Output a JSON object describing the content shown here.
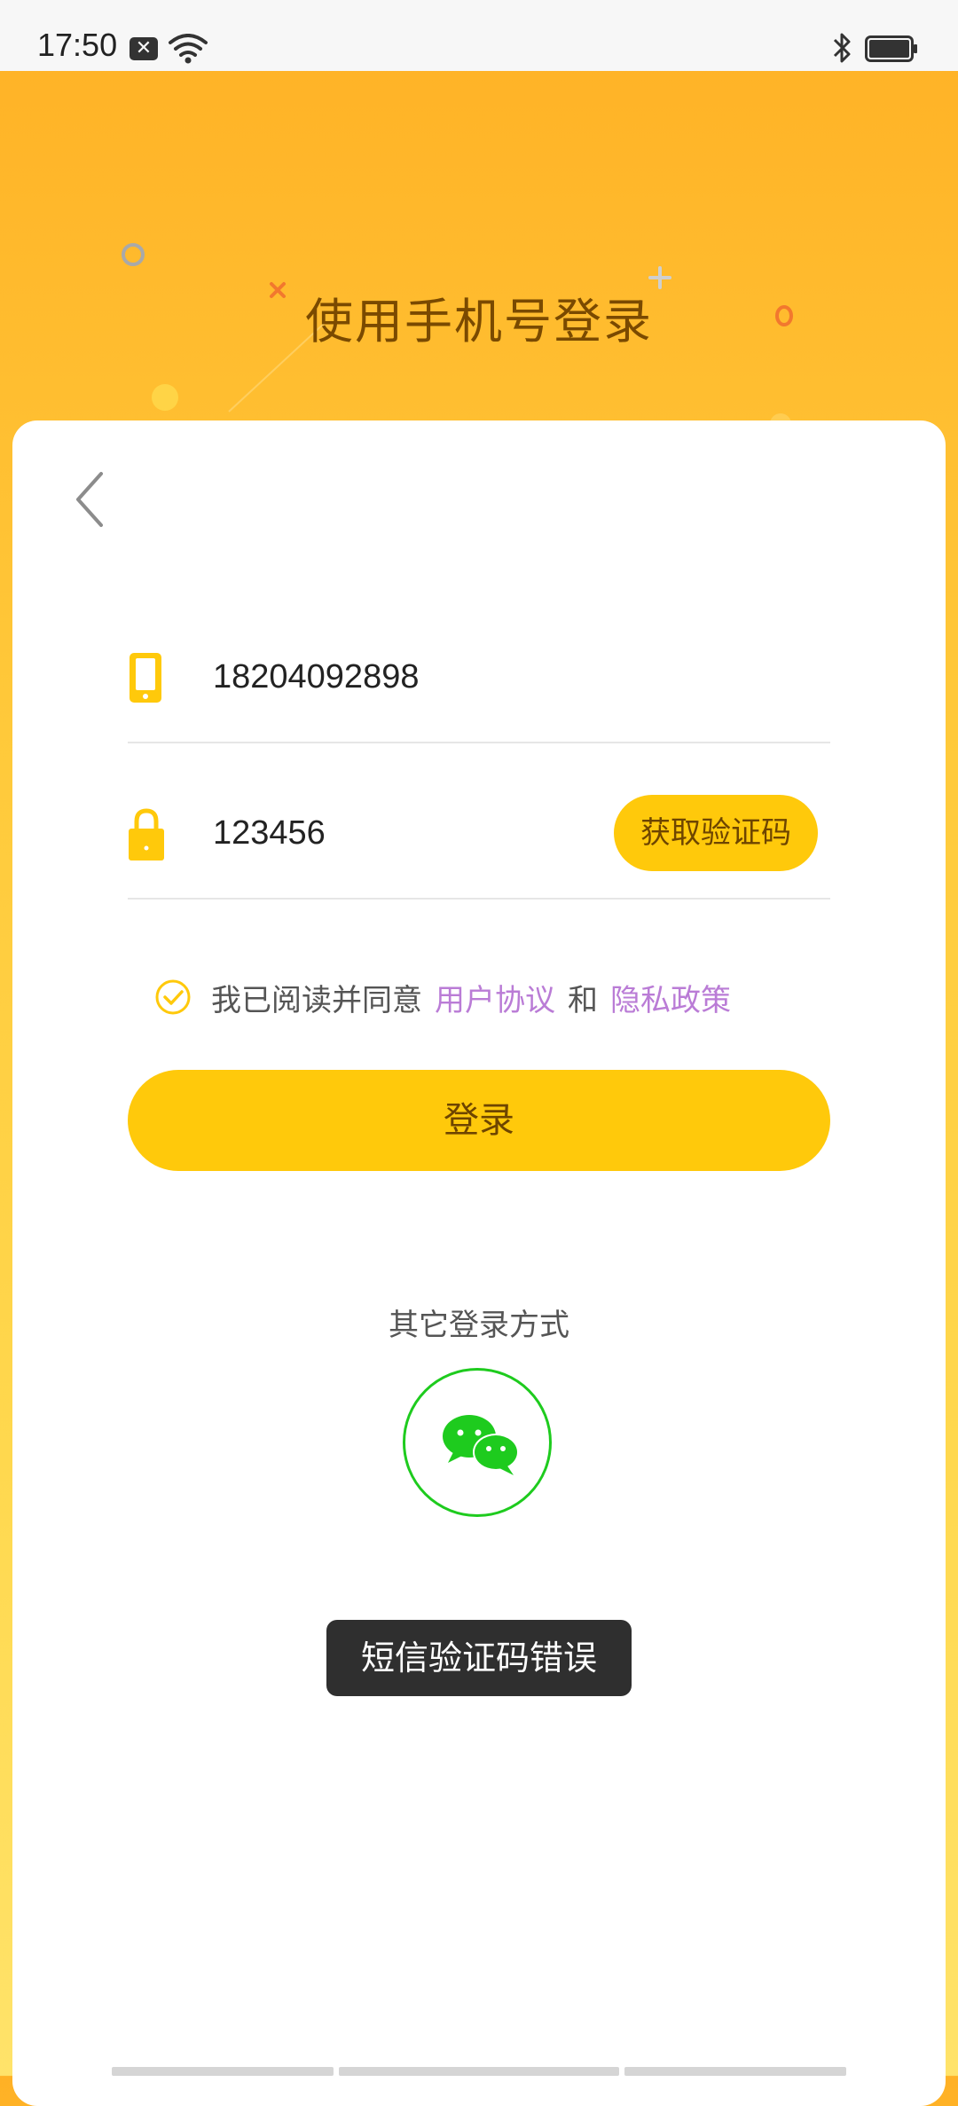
{
  "status_bar": {
    "time": "17:50",
    "notification_glyph": "✕",
    "icons": [
      "notification-icon",
      "wifi-icon",
      "bluetooth-icon",
      "battery-icon"
    ]
  },
  "header": {
    "title": "使用手机号登录"
  },
  "form": {
    "phone": {
      "icon": "phone-icon",
      "value": "18204092898"
    },
    "code": {
      "icon": "lock-icon",
      "value": "123456",
      "get_code_label": "获取验证码"
    },
    "agreement": {
      "checked": true,
      "prefix": "我已阅读并同意",
      "user_agreement": "用户协议",
      "conjunction": "和",
      "privacy_policy": "隐私政策"
    },
    "login_label": "登录"
  },
  "other_login": {
    "label": "其它登录方式",
    "methods": [
      "wechat-icon"
    ]
  },
  "toast": {
    "message": "短信验证码错误"
  },
  "colors": {
    "accent": "#FFC90B",
    "header_gradient_top": "#FFB125",
    "link": "#BA7CD6",
    "wechat_green": "#1ECB1E",
    "toast_bg": "#2F2F2F"
  }
}
